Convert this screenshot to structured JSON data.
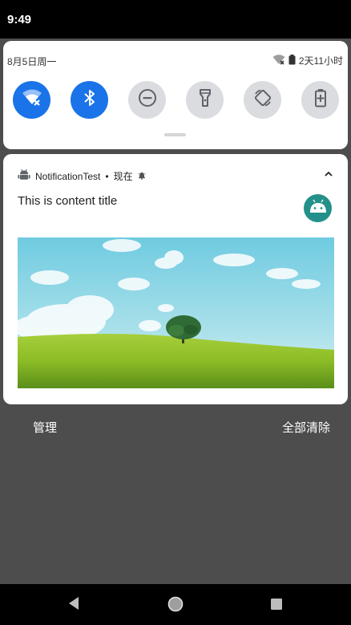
{
  "status_bar": {
    "time": "9:49"
  },
  "quick_settings": {
    "date": "8月5日周一",
    "battery_text": "2天11小时",
    "tiles": [
      {
        "icon": "wifi-off-icon",
        "state": "on"
      },
      {
        "icon": "bluetooth-icon",
        "state": "on"
      },
      {
        "icon": "do-not-disturb-icon",
        "state": "off"
      },
      {
        "icon": "flashlight-icon",
        "state": "off"
      },
      {
        "icon": "auto-rotate-icon",
        "state": "off"
      },
      {
        "icon": "battery-saver-icon",
        "state": "off"
      }
    ]
  },
  "notification": {
    "app_name": "NotificationTest",
    "separator": "•",
    "time": "现在",
    "title": "This is content title",
    "image_description": "tree-on-hill-landscape"
  },
  "actions": {
    "manage": "管理",
    "clear_all": "全部清除"
  },
  "colors": {
    "accent": "#1a73e8",
    "app_icon_bg": "#23908a",
    "scrim": "#4d4d4d",
    "tile_off": "#dadce0"
  }
}
